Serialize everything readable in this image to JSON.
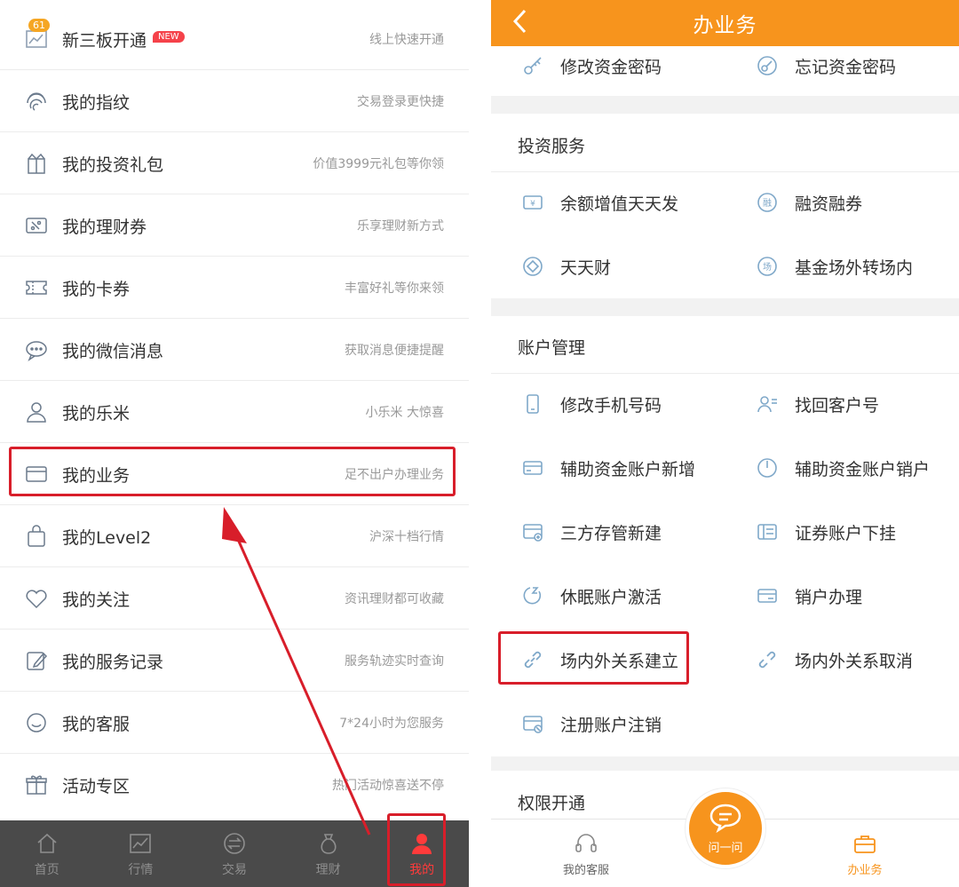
{
  "left_menu": [
    {
      "icon": "chart-icon",
      "title": "新三板开通",
      "subtitle": "线上快速开通",
      "badge_new": "NEW",
      "badge_count": "61"
    },
    {
      "icon": "fingerprint-icon",
      "title": "我的指纹",
      "subtitle": "交易登录更快捷"
    },
    {
      "icon": "gift-icon",
      "title": "我的投资礼包",
      "subtitle": "价值3999元礼包等你领"
    },
    {
      "icon": "coupon-icon",
      "title": "我的理财券",
      "subtitle": "乐享理财新方式"
    },
    {
      "icon": "ticket-icon",
      "title": "我的卡券",
      "subtitle": "丰富好礼等你来领"
    },
    {
      "icon": "chat-icon",
      "title": "我的微信消息",
      "subtitle": "获取消息便捷提醒"
    },
    {
      "icon": "user-icon",
      "title": "我的乐米",
      "subtitle": "小乐米 大惊喜"
    },
    {
      "icon": "card-icon",
      "title": "我的业务",
      "subtitle": "足不出户办理业务"
    },
    {
      "icon": "bag-icon",
      "title": "我的Level2",
      "subtitle": "沪深十档行情"
    },
    {
      "icon": "heart-icon",
      "title": "我的关注",
      "subtitle": "资讯理财都可收藏"
    },
    {
      "icon": "edit-icon",
      "title": "我的服务记录",
      "subtitle": "服务轨迹实时查询"
    },
    {
      "icon": "service-icon",
      "title": "我的客服",
      "subtitle": "7*24小时为您服务"
    },
    {
      "icon": "present-icon",
      "title": "活动专区",
      "subtitle": "热门活动惊喜送不停"
    }
  ],
  "left_tabbar": [
    {
      "icon": "home-icon",
      "label": "首页"
    },
    {
      "icon": "market-icon",
      "label": "行情"
    },
    {
      "icon": "trade-icon",
      "label": "交易"
    },
    {
      "icon": "wealth-icon",
      "label": "理财"
    },
    {
      "icon": "me-icon",
      "label": "我的",
      "active": true
    }
  ],
  "right": {
    "header_title": "办业务",
    "top_items": [
      {
        "icon": "key-icon",
        "label": "修改资金密码"
      },
      {
        "icon": "key-reset-icon",
        "label": "忘记资金密码"
      }
    ],
    "sections": [
      {
        "title": "投资服务",
        "items": [
          {
            "icon": "yuan-icon",
            "label": "余额增值天天发"
          },
          {
            "icon": "finance-icon",
            "label": "融资融券"
          },
          {
            "icon": "diamond-icon",
            "label": "天天财"
          },
          {
            "icon": "transfer-icon",
            "label": "基金场外转场内"
          }
        ]
      },
      {
        "title": "账户管理",
        "items": [
          {
            "icon": "phone-icon",
            "label": "修改手机号码"
          },
          {
            "icon": "find-user-icon",
            "label": "找回客户号"
          },
          {
            "icon": "card-add-icon",
            "label": "辅助资金账户新增"
          },
          {
            "icon": "power-icon",
            "label": "辅助资金账户销户"
          },
          {
            "icon": "depository-icon",
            "label": "三方存管新建"
          },
          {
            "icon": "securities-icon",
            "label": "证券账户下挂"
          },
          {
            "icon": "sleep-icon",
            "label": "休眠账户激活"
          },
          {
            "icon": "close-account-icon",
            "label": "销户办理"
          },
          {
            "icon": "link-icon",
            "label": "场内外关系建立"
          },
          {
            "icon": "unlink-icon",
            "label": "场内外关系取消"
          },
          {
            "icon": "cancel-reg-icon",
            "label": "注册账户注销"
          }
        ]
      },
      {
        "title": "权限开通",
        "items": []
      }
    ],
    "tabbar": [
      {
        "icon": "headset-icon",
        "label": "我的客服"
      },
      {
        "icon": "chat-bubble-icon",
        "label": "问一问"
      },
      {
        "icon": "briefcase-icon",
        "label": "办业务",
        "active": true
      }
    ]
  },
  "colors": {
    "accent_orange": "#f7941d",
    "highlight_red": "#d81e2a",
    "icon_blue": "#7fa8c9",
    "dark_tabbar": "#4a4a4a"
  }
}
